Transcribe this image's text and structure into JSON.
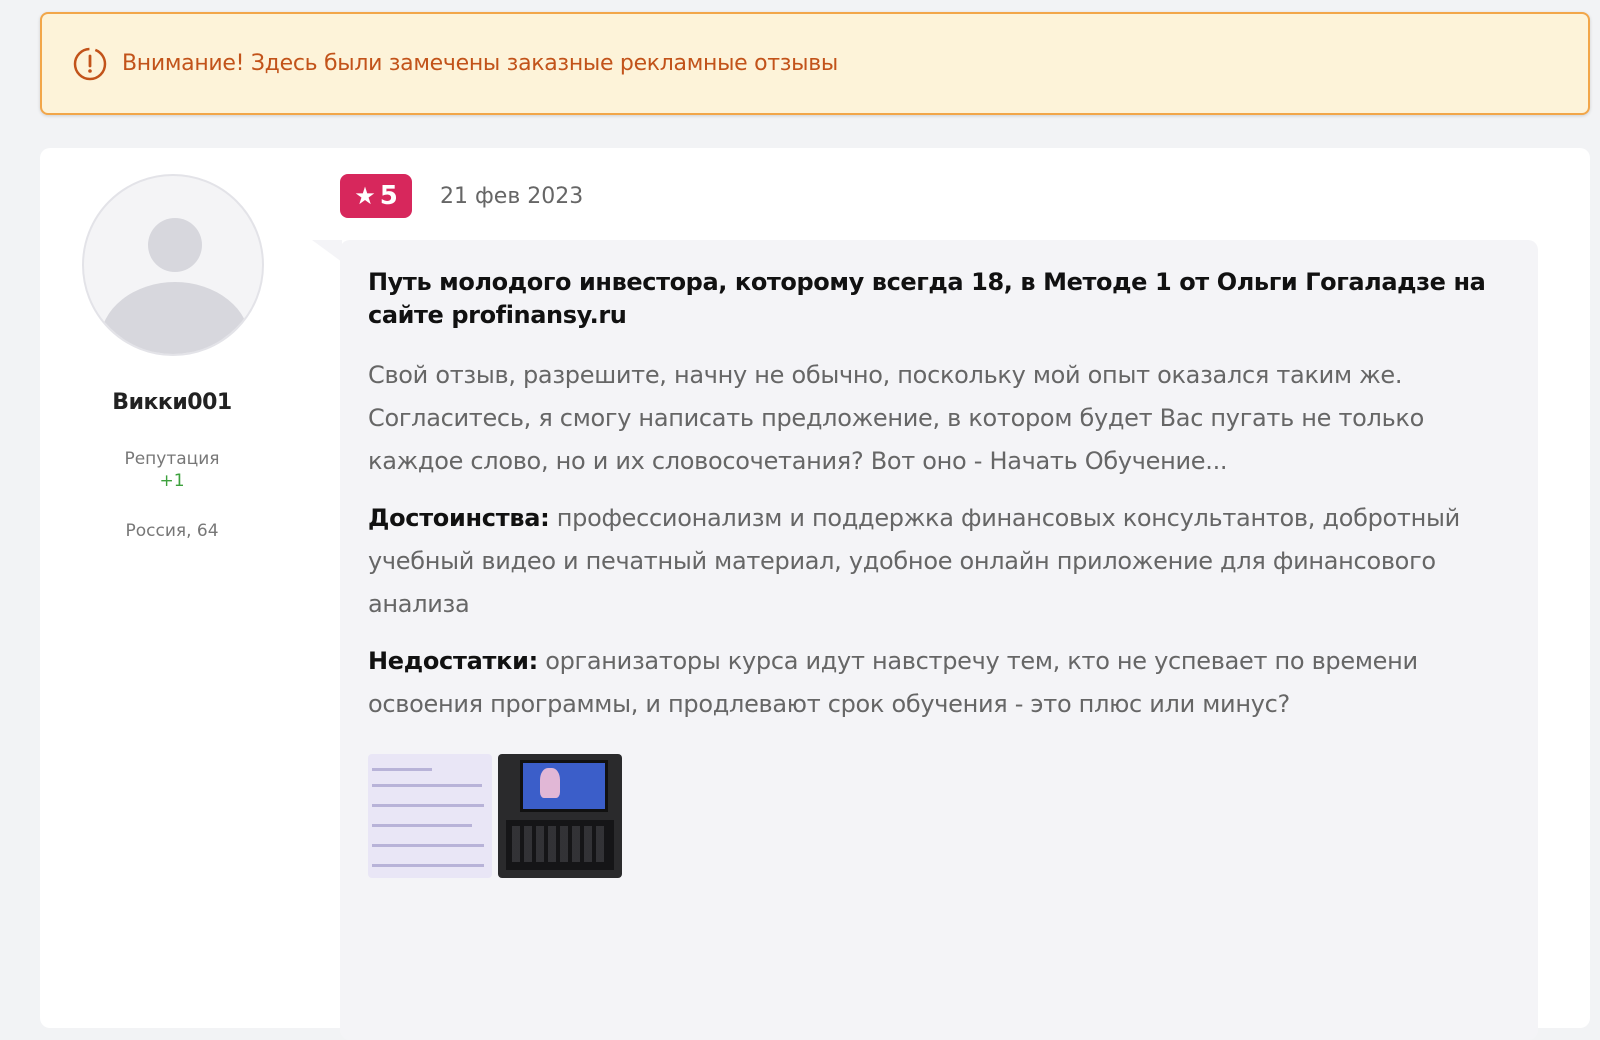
{
  "warning": {
    "icon": "warning-clock-icon",
    "text": "Внимание! Здесь были замечены заказные рекламные отзывы",
    "color": "#c2531a",
    "background": "#fdf3d9",
    "border": "#f2a649"
  },
  "review": {
    "author": {
      "username": "Викки001",
      "reputation_label": "Репутация",
      "reputation_value": "+1",
      "location": "Россия, 64"
    },
    "rating": "5",
    "rating_color": "#d7275c",
    "date": "21 фев 2023",
    "title": "Путь молодого инвестора, которому всегда 18, в Методе 1 от Ольги Гогаладзе на сайте profinansy.ru",
    "text": "Свой отзыв, разрешите, начну не обычно, поскольку мой опыт оказался таким же. Согласитесь, я смогу написать предложение, в котором будет Вас пугать не только каждое слово, но и их словосочетания? Вот оно - Начать Обучение...",
    "pros_label": "Достоинства:",
    "pros": "профессионализм и поддержка финансовых консультантов, добротный учебный видео и печатный материал, удобное онлайн приложение для финансового анализа",
    "cons_label": "Недостатки:",
    "cons": "организаторы курса идут навстречу тем, кто не успевает по времени освоения программы, и продлевают срок обучения - это плюс или минус?"
  }
}
